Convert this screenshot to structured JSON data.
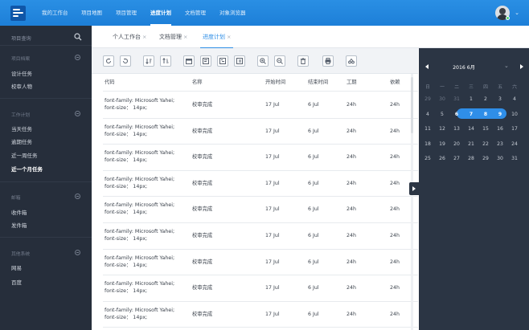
{
  "colors": {
    "topbar": "#2a8fe4",
    "sidebar": "#262e3b",
    "accent": "#2c8de6",
    "right_panel": "#2b3544"
  },
  "nav": [
    {
      "label": "我的工作台"
    },
    {
      "label": "项目地图"
    },
    {
      "label": "项目管理"
    },
    {
      "label": "进度计划",
      "active": true
    },
    {
      "label": "文档管理"
    },
    {
      "label": "对象浏览器"
    }
  ],
  "sidebar": {
    "search_placeholder": "项目查询",
    "sections": [
      {
        "title": "项目档案",
        "items": [
          "设计任务",
          "校审人物"
        ]
      },
      {
        "title": "工作计划",
        "items": [
          "当天任务",
          "逾期任务",
          "近一周任务",
          "近一个月任务"
        ]
      },
      {
        "title": "邮箱",
        "items": [
          "收件箱",
          "发件箱"
        ]
      },
      {
        "title": "其他系统",
        "items": [
          "网易",
          "百度"
        ]
      }
    ]
  },
  "tabs": [
    {
      "label": "个人工作台",
      "close": "×"
    },
    {
      "label": "文档管理",
      "close": "×"
    },
    {
      "label": "进度计划",
      "close": "×",
      "active": true
    }
  ],
  "toolbar_icons": [
    "refresh-icon",
    "undo-icon",
    "sort-ascending-icon",
    "sort-descending-icon",
    "calendar-icon",
    "chart-bar-icon",
    "chart-gantt-icon",
    "indent-icon",
    "zoom-in-icon",
    "zoom-out-icon",
    "delete-icon",
    "print-icon",
    "link-icon"
  ],
  "table": {
    "columns": [
      "代码",
      "名称",
      "开始时间",
      "结束时间",
      "工期",
      "依赖"
    ],
    "rows": [
      {
        "code1": "font-family: Microsoft Yahei;",
        "code2": "font-size： 14px;",
        "name": "校审完成",
        "start": "17 Jul",
        "end": "6 Jul",
        "duration": "24h",
        "dep": "24h"
      },
      {
        "code1": "font-family: Microsoft Yahei;",
        "code2": "font-size： 14px;",
        "name": "校审完成",
        "start": "17 Jul",
        "end": "6 Jul",
        "duration": "24h",
        "dep": "24h"
      },
      {
        "code1": "font-family: Microsoft Yahei;",
        "code2": "font-size： 14px;",
        "name": "校审完成",
        "start": "17 Jul",
        "end": "6 Jul",
        "duration": "24h",
        "dep": "24h"
      },
      {
        "code1": "font-family: Microsoft Yahei;",
        "code2": "font-size： 14px;",
        "name": "校审完成",
        "start": "17 Jul",
        "end": "6 Jul",
        "duration": "24h",
        "dep": "24h"
      },
      {
        "code1": "font-family: Microsoft Yahei;",
        "code2": "font-size： 14px;",
        "name": "校审完成",
        "start": "17 Jul",
        "end": "6 Jul",
        "duration": "24h",
        "dep": "24h"
      },
      {
        "code1": "font-family: Microsoft Yahei;",
        "code2": "font-size： 14px;",
        "name": "校审完成",
        "start": "17 Jul",
        "end": "6 Jul",
        "duration": "24h",
        "dep": "24h"
      },
      {
        "code1": "font-family: Microsoft Yahei;",
        "code2": "font-size： 14px;",
        "name": "校审完成",
        "start": "17 Jul",
        "end": "6 Jul",
        "duration": "24h",
        "dep": "24h"
      },
      {
        "code1": "font-family: Microsoft Yahei;",
        "code2": "font-size： 14px;",
        "name": "校审完成",
        "start": "17 Jul",
        "end": "6 Jul",
        "duration": "24h",
        "dep": "24h"
      },
      {
        "code1": "font-family: Microsoft Yahei;",
        "code2": "font-size： 14px;",
        "name": "校审完成",
        "start": "17 Jul",
        "end": "6 Jul",
        "duration": "24h",
        "dep": "24h"
      }
    ]
  },
  "calendar": {
    "title": "2016 6月",
    "weekdays": [
      "日",
      "一",
      "二",
      "三",
      "四",
      "五",
      "六"
    ],
    "weeks": [
      [
        "29",
        "30",
        "31",
        "1",
        "2",
        "3",
        "4"
      ],
      [
        "4",
        "5",
        "6",
        "7",
        "8",
        "9",
        "10"
      ],
      [
        "11",
        "12",
        "13",
        "14",
        "15",
        "16",
        "17"
      ],
      [
        "18",
        "19",
        "20",
        "21",
        "22",
        "23",
        "24"
      ],
      [
        "25",
        "26",
        "27",
        "28",
        "29",
        "30",
        "31"
      ]
    ],
    "dim_week": 0,
    "selected": {
      "week": 1,
      "from": 2,
      "to": 5
    }
  }
}
